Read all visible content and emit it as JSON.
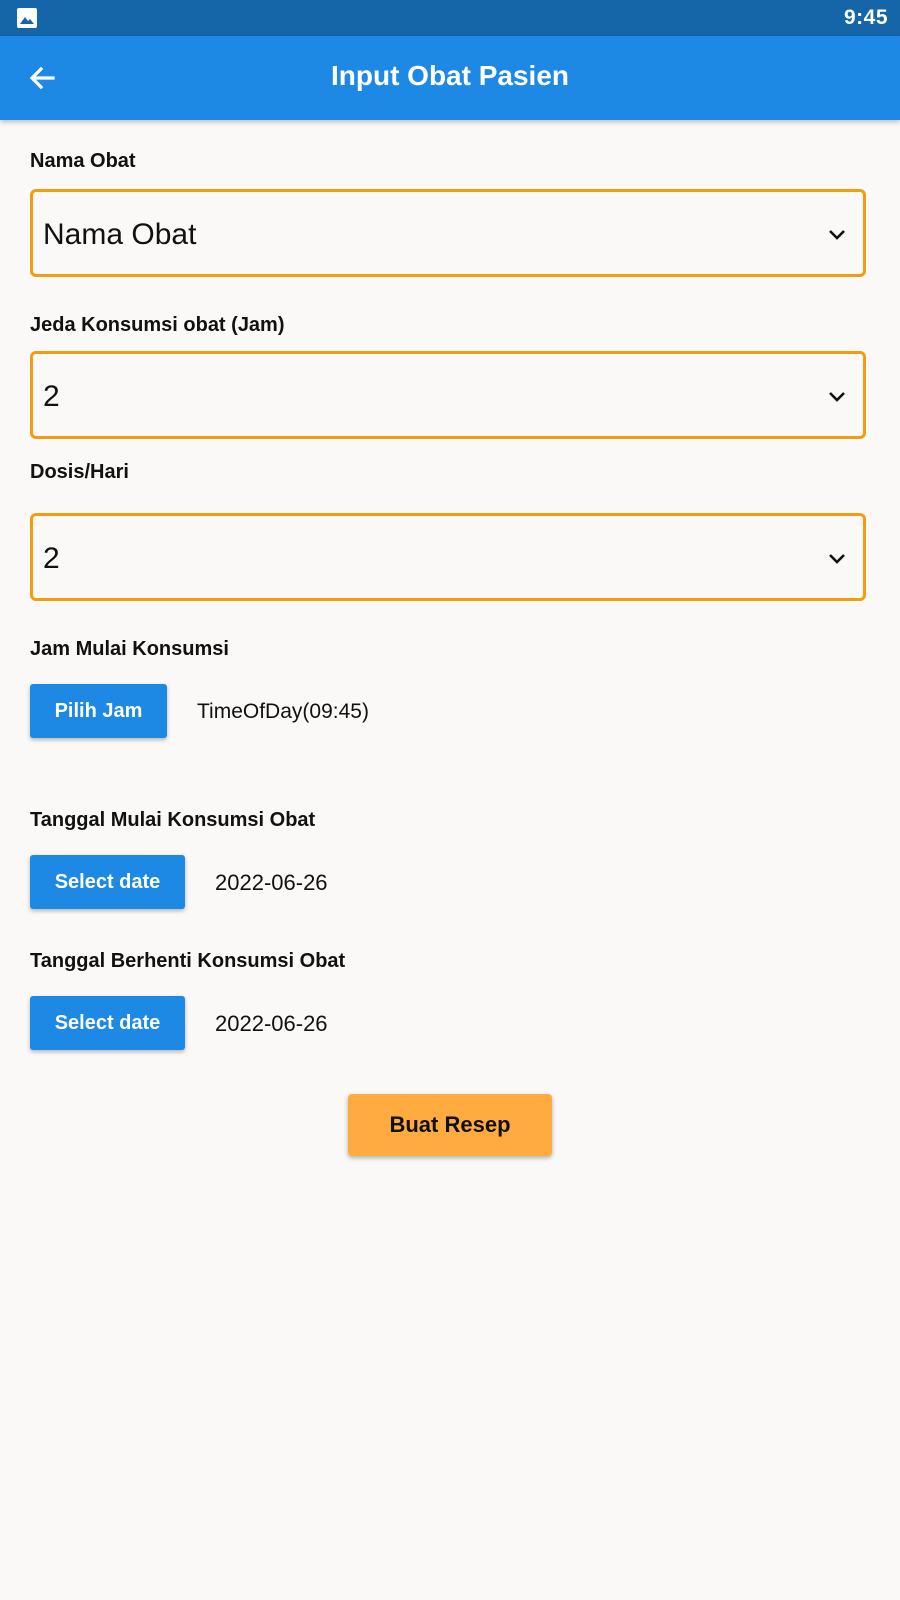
{
  "status_bar": {
    "time": "9:45",
    "notification_icon": "image-icon"
  },
  "app_bar": {
    "title": "Input Obat Pasien",
    "back_icon": "arrow-back-icon"
  },
  "form": {
    "nama_obat": {
      "label": "Nama Obat",
      "value": "Nama Obat"
    },
    "jeda": {
      "label": "Jeda Konsumsi obat (Jam)",
      "value": "2"
    },
    "dosis": {
      "label": "Dosis/Hari",
      "value": "2"
    },
    "jam_mulai": {
      "label": "Jam Mulai Konsumsi",
      "button": "Pilih Jam",
      "value": "TimeOfDay(09:45)"
    },
    "tanggal_mulai": {
      "label": "Tanggal Mulai Konsumsi Obat",
      "button": "Select date",
      "value": "2022-06-26"
    },
    "tanggal_berhenti": {
      "label": "Tanggal Berhenti Konsumsi Obat",
      "button": "Select date",
      "value": "2022-06-26"
    },
    "submit": "Buat Resep"
  },
  "colors": {
    "primary": "#1e88e5",
    "status_bar": "#1565a9",
    "border": "#f39c12",
    "accent": "#ffab40",
    "background": "#faf9f8"
  }
}
